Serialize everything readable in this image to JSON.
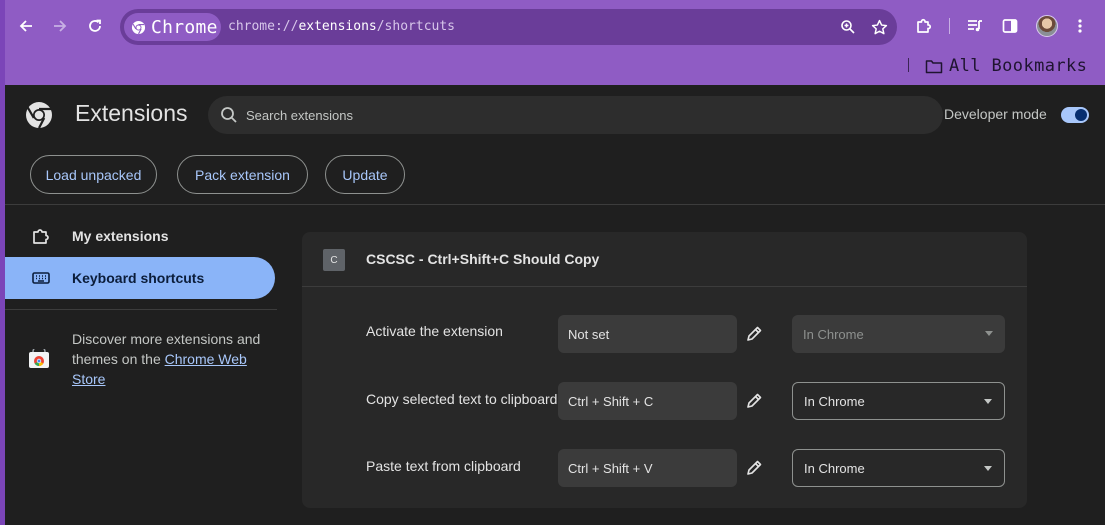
{
  "browser": {
    "site_chip": "Chrome",
    "url_prefix": "chrome://",
    "url_host": "extensions",
    "url_path": "/shortcuts",
    "bookmarks_label": "All Bookmarks",
    "accent": "#8f5cc4"
  },
  "header": {
    "title": "Extensions",
    "search_placeholder": "Search extensions",
    "dev_mode_label": "Developer mode",
    "dev_mode_on": true,
    "buttons": {
      "load_unpacked": "Load unpacked",
      "pack_extension": "Pack extension",
      "update": "Update"
    }
  },
  "sidebar": {
    "items": [
      {
        "label": "My extensions",
        "icon": "puzzle-icon",
        "active": false
      },
      {
        "label": "Keyboard shortcuts",
        "icon": "keyboard-icon",
        "active": true
      }
    ],
    "discover_text": "Discover more extensions and themes on the ",
    "store_link": "Chrome Web Store"
  },
  "extension": {
    "icon_letter": "C",
    "name": "CSCSC - Ctrl+Shift+C Should Copy",
    "commands": [
      {
        "label": "Activate the extension",
        "shortcut": "Not set",
        "scope": "In Chrome",
        "scope_enabled": false
      },
      {
        "label": "Copy selected text to clipboard",
        "shortcut": "Ctrl + Shift + C",
        "scope": "In Chrome",
        "scope_enabled": true
      },
      {
        "label": "Paste text from clipboard",
        "shortcut": "Ctrl + Shift + V",
        "scope": "In Chrome",
        "scope_enabled": true
      }
    ]
  }
}
